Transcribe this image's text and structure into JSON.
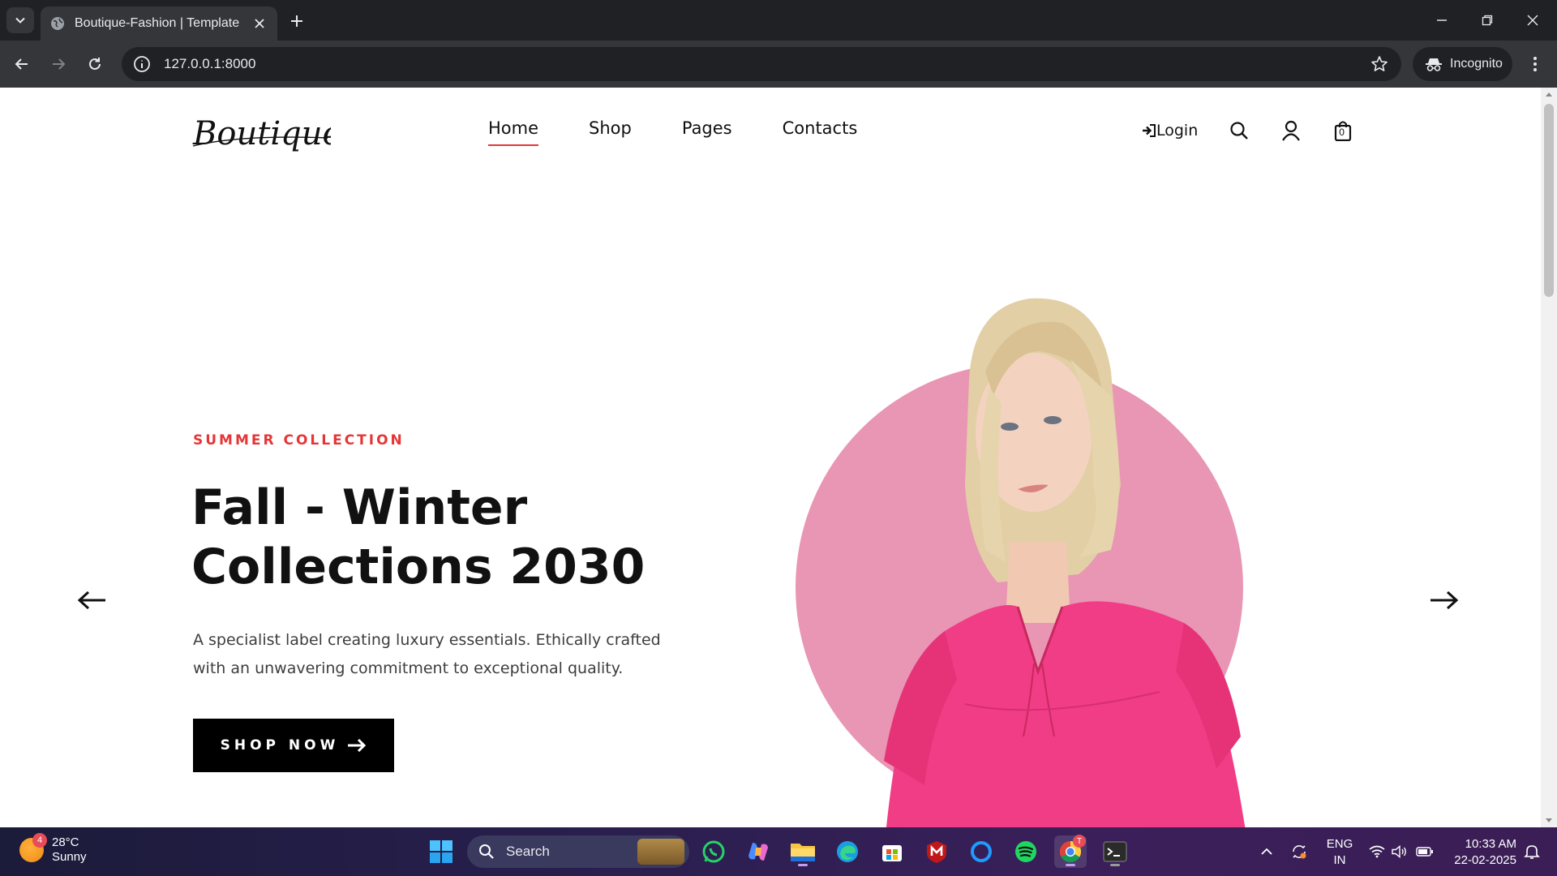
{
  "browser": {
    "tab_title": "Boutique-Fashion | Template",
    "url": "127.0.0.1:8000",
    "profile_label": "Incognito"
  },
  "site": {
    "logo_text": "Boutique",
    "nav": [
      {
        "label": "Home",
        "active": true
      },
      {
        "label": "Shop",
        "active": false
      },
      {
        "label": "Pages",
        "active": false
      },
      {
        "label": "Contacts",
        "active": false
      }
    ],
    "login_label": "Login",
    "cart_count": "0"
  },
  "hero": {
    "subtitle": "SUMMER COLLECTION",
    "headline_line1": "Fall - Winter",
    "headline_line2": "Collections 2030",
    "description": "A specialist label creating luxury essentials. Ethically crafted with an unwavering commitment to exceptional quality.",
    "cta_label": "SHOP NOW",
    "accent_color": "#e53637",
    "circle_color": "#e995b4",
    "dress_color": "#f03d86"
  },
  "taskbar": {
    "weather_temp": "28°C",
    "weather_desc": "Sunny",
    "weather_badge": "4",
    "search_label": "Search",
    "lang_line1": "ENG",
    "lang_line2": "IN",
    "time": "10:33 AM",
    "date": "22-02-2025",
    "chrome_badge": "T",
    "pinned_apps": [
      "whatsapp-icon",
      "copilot-icon",
      "file-explorer-icon",
      "edge-icon",
      "store-icon",
      "mcafee-icon",
      "cortana-icon",
      "spotify-icon",
      "chrome-icon",
      "terminal-icon"
    ]
  }
}
